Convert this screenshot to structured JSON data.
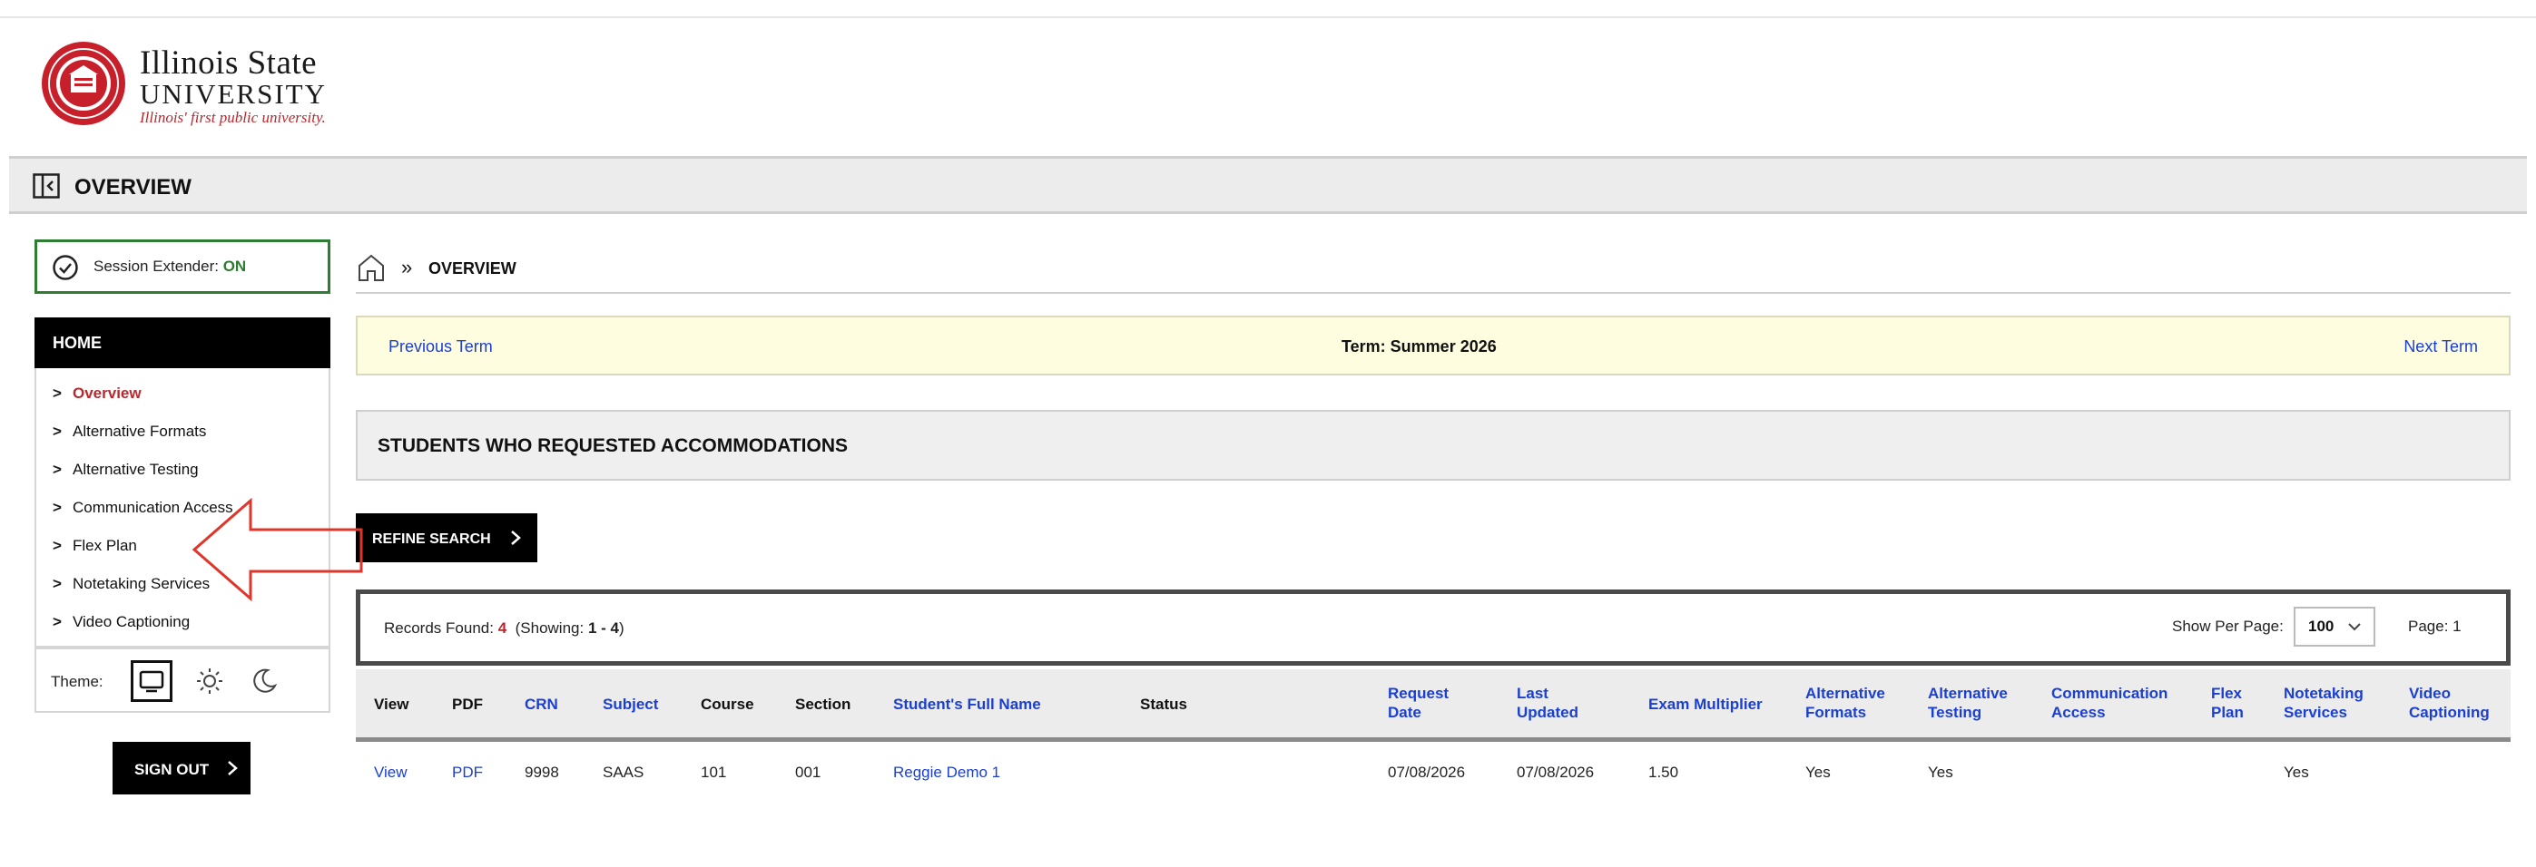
{
  "logo": {
    "line1": "Illinois State",
    "line2": "UNIVERSITY",
    "tagline": "Illinois' first public university."
  },
  "header": {
    "title": "OVERVIEW"
  },
  "session": {
    "label": "Session Extender: ",
    "status": "ON"
  },
  "sidebar": {
    "home_label": "HOME",
    "items": [
      {
        "label": "Overview"
      },
      {
        "label": "Alternative Formats"
      },
      {
        "label": "Alternative Testing"
      },
      {
        "label": "Communication Access"
      },
      {
        "label": "Flex Plan"
      },
      {
        "label": "Notetaking Services"
      },
      {
        "label": "Video Captioning"
      }
    ],
    "theme_label": "Theme:",
    "signout_label": "SIGN OUT"
  },
  "breadcrumb": {
    "current": "OVERVIEW"
  },
  "term": {
    "prev": "Previous Term",
    "current": "Term: Summer 2026",
    "next": "Next Term"
  },
  "section": {
    "title": "STUDENTS WHO REQUESTED ACCOMMODATIONS"
  },
  "refine_label": "REFINE SEARCH",
  "records": {
    "found_label": "Records Found: ",
    "count": "4",
    "showing_label": "(Showing: ",
    "showing_value": "1 - 4",
    "showing_close": ")",
    "per_page_label": "Show Per Page:",
    "per_page_value": "100",
    "page_label": "Page: 1"
  },
  "table": {
    "headers": {
      "view": "View",
      "pdf": "PDF",
      "crn": "CRN",
      "subject": "Subject",
      "course": "Course",
      "section": "Section",
      "student": "Student's Full Name",
      "status": "Status",
      "request_date_1": "Request",
      "request_date_2": "Date",
      "last_updated_1": "Last",
      "last_updated_2": "Updated",
      "exam_multiplier": "Exam Multiplier",
      "alt_formats_1": "Alternative",
      "alt_formats_2": "Formats",
      "alt_testing_1": "Alternative",
      "alt_testing_2": "Testing",
      "comm_access_1": "Communication",
      "comm_access_2": "Access",
      "flex_plan_1": "Flex",
      "flex_plan_2": "Plan",
      "notetaking_1": "Notetaking",
      "notetaking_2": "Services",
      "video_1": "Video",
      "video_2": "Captioning"
    },
    "rows": [
      {
        "view": "View",
        "pdf": "PDF",
        "crn": "9998",
        "subject": "SAAS",
        "course": "101",
        "section": "001",
        "student": "Reggie Demo 1",
        "status": "",
        "request_date": "07/08/2026",
        "last_updated": "07/08/2026",
        "exam_multiplier": "1.50",
        "alt_formats": "Yes",
        "alt_testing": "Yes",
        "comm_access": "",
        "flex_plan": "",
        "notetaking": "Yes",
        "video": ""
      }
    ]
  },
  "colors": {
    "brand_red": "#b8282f",
    "link_blue": "#1a3fd1",
    "success_green": "#2e7d32",
    "annotation_red": "#e0352b"
  }
}
